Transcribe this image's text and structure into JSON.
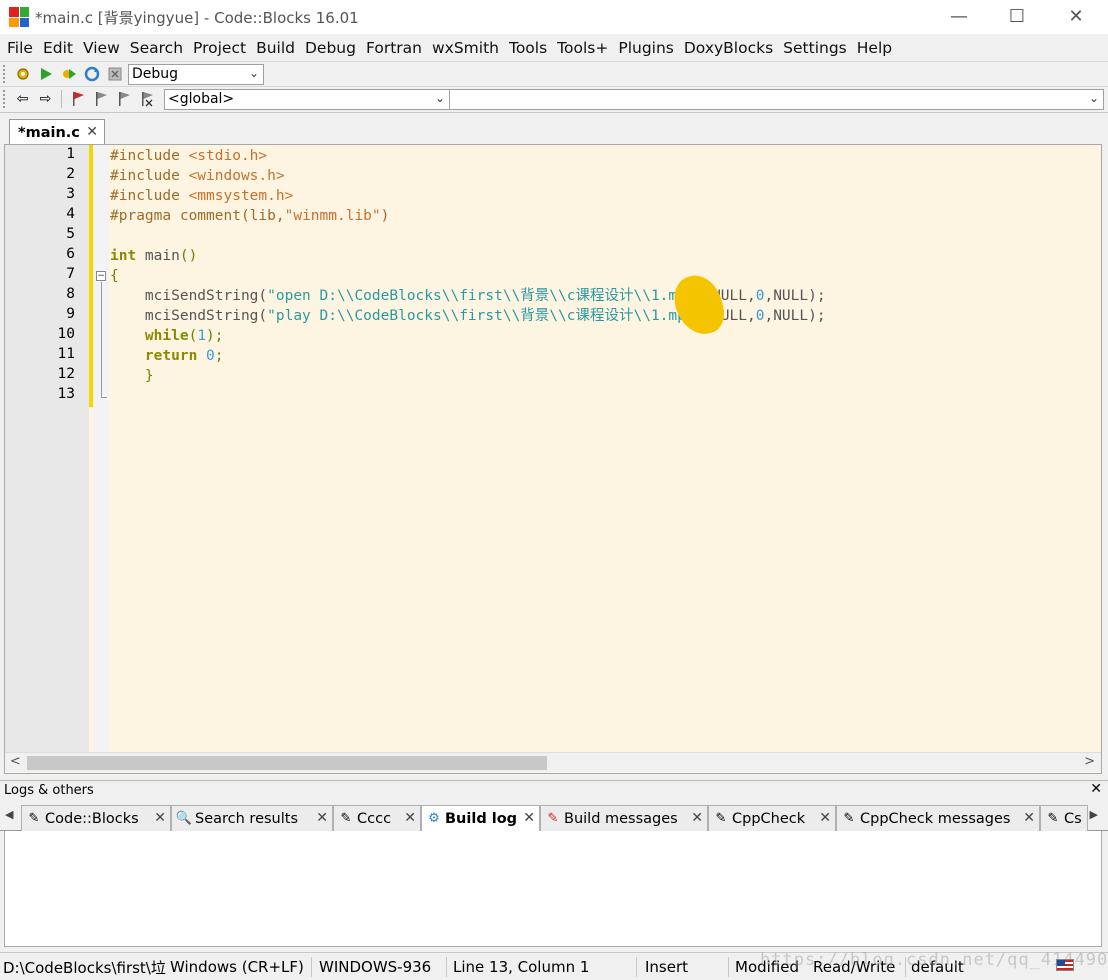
{
  "window": {
    "title": "*main.c [背景yingyue] - Code::Blocks 16.01",
    "minimize": "—",
    "maximize": "☐",
    "close": "✕"
  },
  "menu": [
    "File",
    "Edit",
    "View",
    "Search",
    "Project",
    "Build",
    "Debug",
    "Fortran",
    "wxSmith",
    "Tools",
    "Tools+",
    "Plugins",
    "DoxyBlocks",
    "Settings",
    "Help"
  ],
  "toolbar": {
    "build_target": "Debug",
    "scope": "<global>"
  },
  "editor": {
    "tab_label": "*main.c",
    "tab_close": "✕",
    "line_numbers": [
      "1",
      "2",
      "3",
      "4",
      "5",
      "6",
      "7",
      "8",
      "9",
      "10",
      "11",
      "12",
      "13"
    ],
    "code": {
      "l1a": "#include ",
      "l1b": "<stdio.h>",
      "l2a": "#include ",
      "l2b": "<windows.h>",
      "l3a": "#include ",
      "l3b": "<mmsystem.h>",
      "l4a": "#pragma comment",
      "l4b": "(lib,",
      "l4c": "\"winmm.lib\"",
      "l4d": ")",
      "l6a": "int",
      "l6b": " main",
      "l6c": "()",
      "l7": "{",
      "l8a": "    mciSendString(",
      "l8b": "\"open D:\\\\CodeBlocks\\\\first\\\\背景\\\\c课程设计\\\\1.mp3\"",
      "l8c": ",NULL,",
      "l8d": "0",
      "l8e": ",NULL);",
      "l9a": "    mciSendString(",
      "l9b": "\"play D:\\\\CodeBlocks\\\\first\\\\背景\\\\c课程设计\\\\1.mp3\"",
      "l9c": ",NULL,",
      "l9d": "0",
      "l9e": ",NULL);",
      "l10a": "    ",
      "l10b": "while",
      "l10c": "(",
      "l10d": "1",
      "l10e": ");",
      "l11a": "    ",
      "l11b": "return",
      "l11c": " ",
      "l11d": "0",
      "l11e": ";",
      "l12": "    }"
    }
  },
  "logs": {
    "title": "Logs & others",
    "close": "✕",
    "tabs": [
      {
        "label": "Code::Blocks",
        "icon": "✎"
      },
      {
        "label": "Search results",
        "icon": "🔍"
      },
      {
        "label": "Cccc",
        "icon": "✎"
      },
      {
        "label": "Build log",
        "icon": "⚙"
      },
      {
        "label": "Build messages",
        "icon": "✎"
      },
      {
        "label": "CppCheck",
        "icon": "✎"
      },
      {
        "label": "CppCheck messages",
        "icon": "✎"
      },
      {
        "label": "Cs",
        "icon": "✎"
      }
    ],
    "tab_close": "✕"
  },
  "status": {
    "path": "D:\\CodeBlocks\\first\\垃",
    "eol": "Windows (CR+LF)",
    "encoding": "WINDOWS-936",
    "position": "Line 13, Column 1",
    "mode": "Insert",
    "modified": "Modified",
    "access": "Read/Write",
    "profile": "default",
    "watermark": "https://blog.csdn.net/qq_41449087"
  },
  "colors": {
    "editor_bg": "#fdf5e2",
    "change_bar": "#f0d800",
    "string": "#2b9aa0",
    "keyword": "#8a8a00",
    "preprocessor": "#a06b28"
  }
}
